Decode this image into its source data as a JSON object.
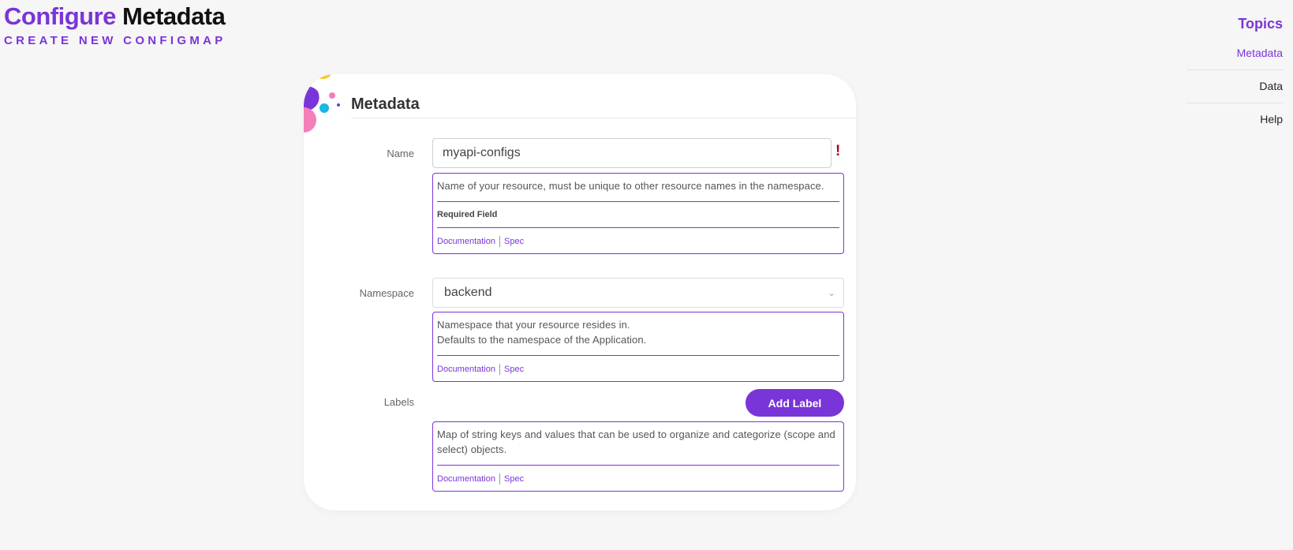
{
  "header": {
    "title_accent": "Configure",
    "title_main": "Metadata",
    "subtitle": "CREATE NEW CONFIGMAP"
  },
  "topics": {
    "title": "Topics",
    "items": [
      {
        "label": "Metadata",
        "active": true
      },
      {
        "label": "Data",
        "active": false
      },
      {
        "label": "Help",
        "active": false
      }
    ]
  },
  "card": {
    "title": "Metadata",
    "name": {
      "label": "Name",
      "value": "myapi-configs",
      "required_mark": "!",
      "help": "Name of your resource, must be unique to other resource names in the namespace.",
      "required_text": "Required Field",
      "doc_link": "Documentation",
      "spec_link": "Spec"
    },
    "namespace": {
      "label": "Namespace",
      "value": "backend",
      "help_line1": "Namespace that your resource resides in.",
      "help_line2": "Defaults to the namespace of the Application.",
      "doc_link": "Documentation",
      "spec_link": "Spec"
    },
    "labels": {
      "label": "Labels",
      "button": "Add Label",
      "help": "Map of string keys and values that can be used to organize and categorize (scope and select) objects.",
      "doc_link": "Documentation",
      "spec_link": "Spec"
    }
  },
  "colors": {
    "accent": "#7a35d8",
    "required": "#c0001a",
    "deco_yellow": "#fac520",
    "deco_pink": "#f47fb8",
    "deco_blue": "#1ab8e4"
  },
  "icons": {
    "namespace_dropdown": "chevron-down-icon",
    "decoration": "bubbles-decoration"
  }
}
